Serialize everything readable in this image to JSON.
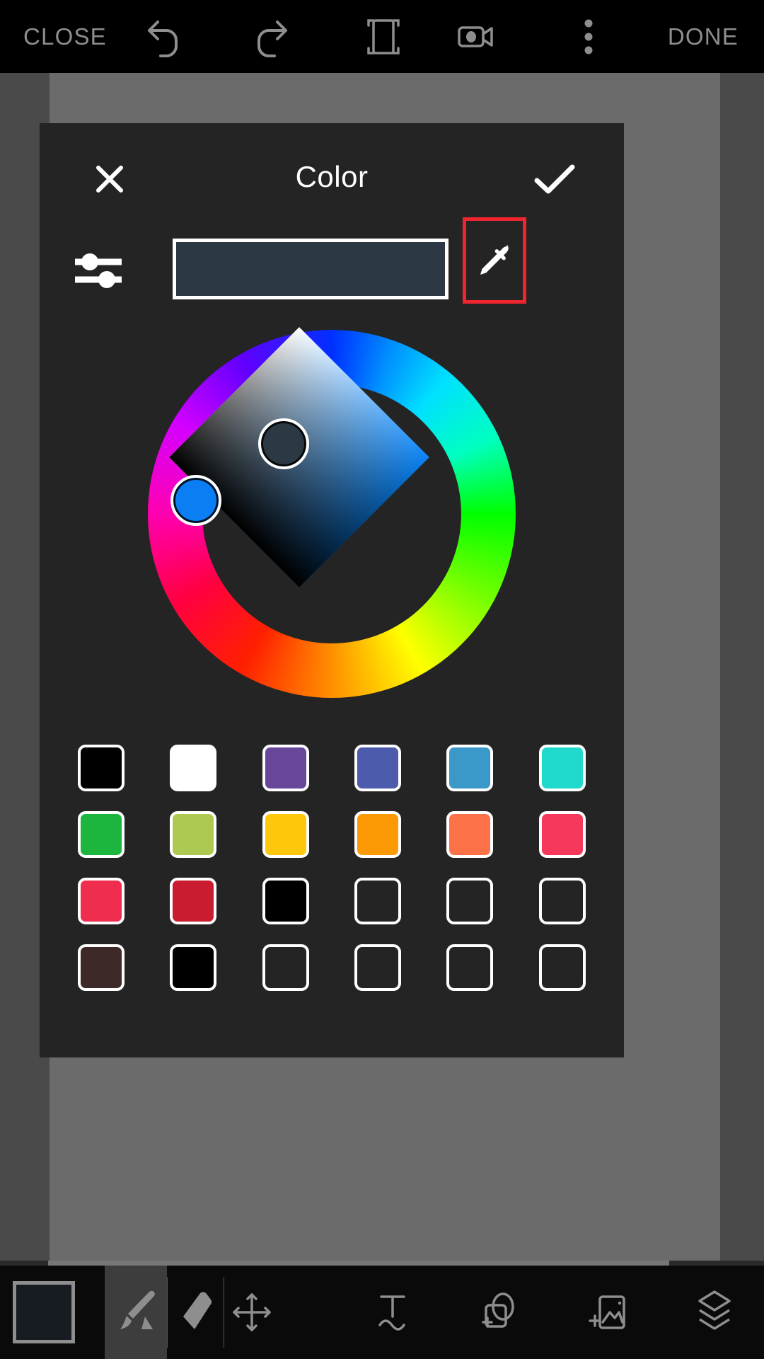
{
  "topbar": {
    "close_label": "CLOSE",
    "done_label": "DONE",
    "icons": [
      {
        "name": "undo-icon",
        "label": "Undo"
      },
      {
        "name": "redo-icon",
        "label": "Redo"
      },
      {
        "name": "crop-frame-icon",
        "label": "Crop / Frame"
      },
      {
        "name": "camera-video-icon",
        "label": "Record"
      },
      {
        "name": "overflow-menu-icon",
        "label": "More options"
      }
    ]
  },
  "dialog": {
    "title": "Color",
    "close_icon": "close-x-icon",
    "confirm_icon": "checkmark-icon",
    "sliders_icon": "sliders-icon",
    "eyedropper_icon": "eyedropper-icon",
    "eyedropper_highlighted": true,
    "highlight_color": "#f2252f",
    "background": "#242424",
    "preview": {
      "current_color": "#2c3844",
      "border_color": "#ffffff"
    },
    "wheel": {
      "hue_handle_color": "#0b7ef4",
      "sv_handle_color": "#2c3844",
      "hue_degrees": 205,
      "diamond_tip_color": "#ffffff",
      "diamond_right_color": "#0a84f5"
    },
    "swatches": [
      {
        "color": "#000000",
        "name": "black"
      },
      {
        "color": "#ffffff",
        "name": "white"
      },
      {
        "color": "#68479b",
        "name": "purple"
      },
      {
        "color": "#4d5bad",
        "name": "indigo"
      },
      {
        "color": "#3a99c9",
        "name": "blue"
      },
      {
        "color": "#1fd9cc",
        "name": "turquoise"
      },
      {
        "color": "#1cb63e",
        "name": "green"
      },
      {
        "color": "#aec952",
        "name": "lime"
      },
      {
        "color": "#fdc70c",
        "name": "yellow"
      },
      {
        "color": "#fc9a06",
        "name": "orange"
      },
      {
        "color": "#fd7149",
        "name": "coral"
      },
      {
        "color": "#f5385c",
        "name": "pink-red"
      },
      {
        "color": "#ef2d4f",
        "name": "red-pink"
      },
      {
        "color": "#cb1b30",
        "name": "crimson"
      },
      {
        "color": "#000000",
        "name": "black-2"
      },
      {
        "color": "#242424",
        "name": "empty-1"
      },
      {
        "color": "#242424",
        "name": "empty-2"
      },
      {
        "color": "#242424",
        "name": "empty-3"
      },
      {
        "color": "#3d2a28",
        "name": "dark-brown"
      },
      {
        "color": "#000000",
        "name": "black-3"
      },
      {
        "color": "#242424",
        "name": "empty-4"
      },
      {
        "color": "#242424",
        "name": "empty-5"
      },
      {
        "color": "#242424",
        "name": "empty-6"
      },
      {
        "color": "#242424",
        "name": "empty-7"
      }
    ]
  },
  "bottombar": {
    "active_tool": "brush",
    "current_color": "#171c22",
    "tools": [
      {
        "name": "color-swatch-button",
        "label": "Color"
      },
      {
        "name": "brush-tool",
        "label": "Brush"
      },
      {
        "name": "eraser-tool",
        "label": "Eraser"
      },
      {
        "name": "transform-tool",
        "label": "Transform"
      },
      {
        "name": "text-tool",
        "label": "Text"
      },
      {
        "name": "add-shape-tool",
        "label": "Add shape"
      },
      {
        "name": "add-image-tool",
        "label": "Add image"
      },
      {
        "name": "layers-tool",
        "label": "Layers"
      }
    ]
  }
}
